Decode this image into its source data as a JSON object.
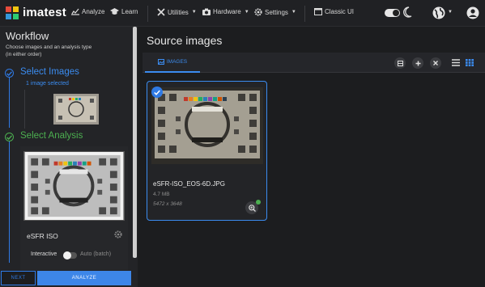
{
  "app": {
    "brand": "imatest"
  },
  "nav": {
    "analyze": "Analyze",
    "learn": "Learn",
    "utilities": "Utilities",
    "hardware": "Hardware",
    "settings": "Settings",
    "classic_ui": "Classic UI"
  },
  "workflow": {
    "title": "Workflow",
    "subtitle": "Choose images and an analysis type",
    "subtitle2": "(in either order)",
    "step1_title": "Select Images",
    "step1_status": "1 image selected",
    "step2_title": "Select Analysis",
    "analysis_name": "eSFR ISO",
    "interactive_label": "Interactive",
    "auto_label": "Auto (batch)",
    "interactive_mode": false
  },
  "actions": {
    "next": "NEXT",
    "analyze": "ANALYZE"
  },
  "source": {
    "title": "Source images",
    "tab_images": "IMAGES",
    "file": {
      "name": "eSFR-ISO_EOS-6D.JPG",
      "size": "4.7 MB",
      "dimensions": "5472 x 3648",
      "selected": true
    }
  },
  "colors": {
    "accent": "#3b8cf0",
    "success": "#4caf50",
    "background": "#1c1d1f"
  }
}
